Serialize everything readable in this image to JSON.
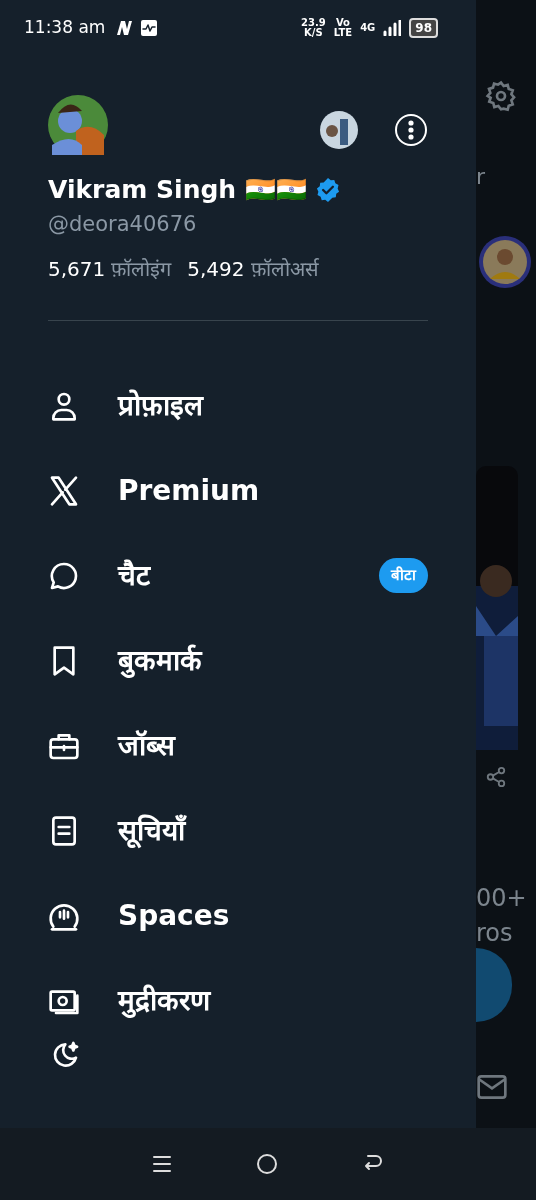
{
  "status_bar": {
    "time": "11:38 am",
    "speed": "23.9",
    "speed_unit": "K/S",
    "volte_top": "Vo",
    "volte_bottom": "LTE",
    "network": "4G",
    "battery": "98"
  },
  "drawer": {
    "name": "Vikram Singh 🇮🇳🇮🇳",
    "verified": true,
    "handle": "@deora40676",
    "following_count": "5,671",
    "following_label": "फ़ॉलोइंग",
    "followers_count": "5,492",
    "followers_label": "फ़ॉलोअर्स",
    "menu": [
      {
        "kind": "person",
        "label": "प्रोफ़ाइल"
      },
      {
        "kind": "x",
        "label": "Premium"
      },
      {
        "kind": "chat",
        "label": "चैट",
        "badge": "बीटा"
      },
      {
        "kind": "bookmark",
        "label": "बुकमार्क"
      },
      {
        "kind": "briefcase",
        "label": "जॉब्स"
      },
      {
        "kind": "list",
        "label": "सूचियाँ"
      },
      {
        "kind": "spaces",
        "label": "Spaces"
      },
      {
        "kind": "money",
        "label": "मुद्रीकरण"
      }
    ]
  },
  "background_feed": {
    "dropdown_text": "r",
    "count_text": "00+",
    "partial_text": "ros"
  }
}
